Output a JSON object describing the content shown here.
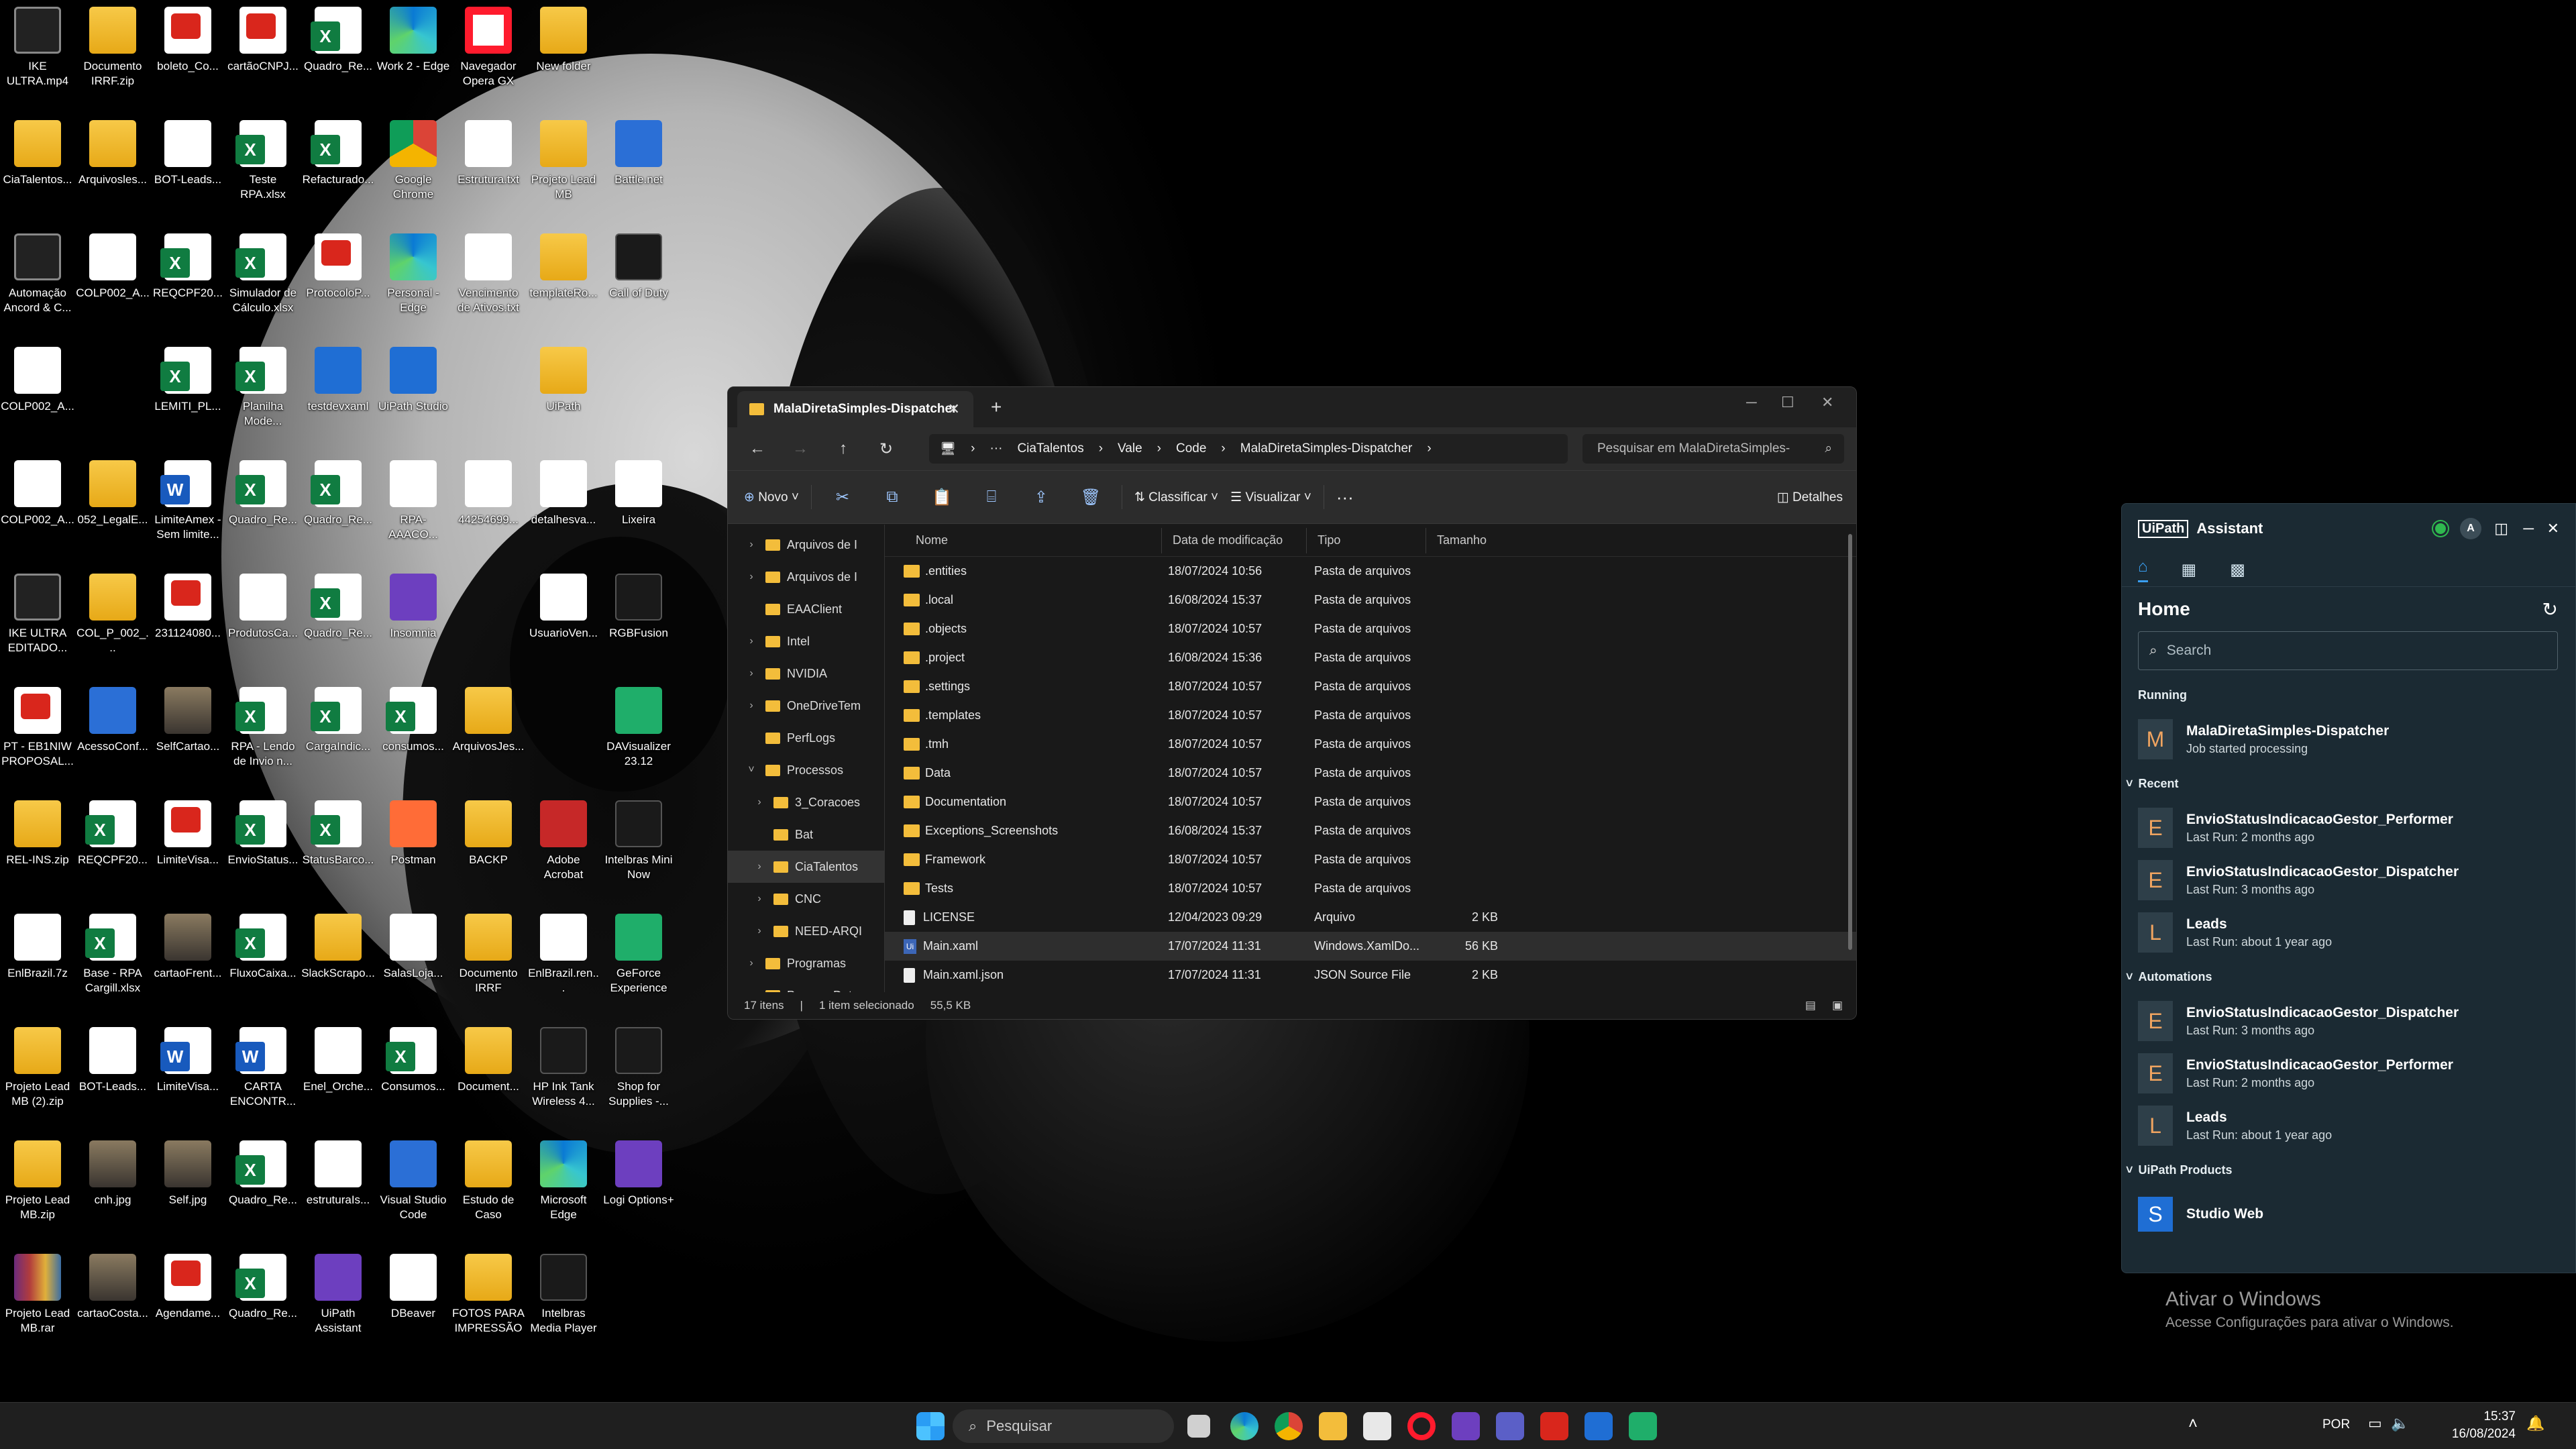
{
  "desktop_icons": [
    {
      "label": "IKE ULTRA.mp4",
      "kind": "video"
    },
    {
      "label": "Documento IRRF.zip",
      "kind": "folder"
    },
    {
      "label": "boleto_Co...",
      "kind": "pdf"
    },
    {
      "label": "cartãoCNPJ...",
      "kind": "pdf"
    },
    {
      "label": "Quadro_Re...",
      "kind": "xls"
    },
    {
      "label": "Work 2 - Edge",
      "kind": "edge"
    },
    {
      "label": "Navegador Opera GX",
      "kind": "opera"
    },
    {
      "label": "New folder",
      "kind": "folder"
    },
    {
      "label": "CiaTalentos...",
      "kind": "folder"
    },
    {
      "label": "Arquivosles...",
      "kind": "folder"
    },
    {
      "label": "BOT-Leads...",
      "kind": "doc"
    },
    {
      "label": "Teste RPA.xlsx",
      "kind": "xls"
    },
    {
      "label": "Refacturado...",
      "kind": "xls"
    },
    {
      "label": "Google Chrome",
      "kind": "chrome"
    },
    {
      "label": "Estrutura.txt",
      "kind": "doc"
    },
    {
      "label": "Projeto Lead MB",
      "kind": "folder"
    },
    {
      "label": "Battle.net",
      "kind": "blue"
    },
    {
      "label": "Automação Ancord & C...",
      "kind": "video"
    },
    {
      "label": "COLP002_A...",
      "kind": "doc"
    },
    {
      "label": "REQCPF20...",
      "kind": "xls"
    },
    {
      "label": "Simulador de Cálculo.xlsx",
      "kind": "xls"
    },
    {
      "label": "ProtocoloP...",
      "kind": "pdf"
    },
    {
      "label": "Personal - Edge",
      "kind": "edge"
    },
    {
      "label": "Vencimento de Ativos.txt",
      "kind": "doc"
    },
    {
      "label": "templateRo...",
      "kind": "folder"
    },
    {
      "label": "Call of Duty",
      "kind": "dark"
    },
    {
      "label": "COLP002_A...",
      "kind": "doc"
    },
    {
      "label": "LEMITI_PL...",
      "kind": "xls"
    },
    {
      "label": "Planilha Mode...",
      "kind": "xls"
    },
    {
      "label": "testdevxaml",
      "kind": "ui"
    },
    {
      "label": "UiPath Studio",
      "kind": "ui"
    },
    {
      "label": "UiPath",
      "kind": "folder"
    },
    {
      "label": "COLP002_A...",
      "kind": "doc"
    },
    {
      "label": "052_LegalE...",
      "kind": "folder"
    },
    {
      "label": "LimiteAmex - Sem limite...",
      "kind": "word"
    },
    {
      "label": "Quadro_Re...",
      "kind": "xls"
    },
    {
      "label": "Quadro_Re...",
      "kind": "xls"
    },
    {
      "label": "RPA-AAACO...",
      "kind": "doc"
    },
    {
      "label": "44254699...",
      "kind": "doc"
    },
    {
      "label": "detalhesva...",
      "kind": "doc"
    },
    {
      "label": "Lixeira",
      "kind": "doc"
    },
    {
      "label": "IKE ULTRA EDITADO...",
      "kind": "video"
    },
    {
      "label": "COL_P_002_...",
      "kind": "folder"
    },
    {
      "label": "231124080...",
      "kind": "pdf"
    },
    {
      "label": "ProdutosCa...",
      "kind": "doc"
    },
    {
      "label": "Quadro_Re...",
      "kind": "xls"
    },
    {
      "label": "Insomnia",
      "kind": "purple"
    },
    {
      "label": "UsuarioVen...",
      "kind": "doc"
    },
    {
      "label": "RGBFusion",
      "kind": "dark"
    },
    {
      "label": "PT - EB1NIW PROPOSAL...",
      "kind": "pdf"
    },
    {
      "label": "AcessoConf...",
      "kind": "blue"
    },
    {
      "label": "SelfCartao...",
      "kind": "img"
    },
    {
      "label": "RPA - Lendo de Invio n...",
      "kind": "xls"
    },
    {
      "label": "CargaIndic...",
      "kind": "xls"
    },
    {
      "label": "consumos...",
      "kind": "xls"
    },
    {
      "label": "ArquivosJes...",
      "kind": "folder"
    },
    {
      "label": "DAVisualizer 23.12",
      "kind": "green"
    },
    {
      "label": "REL-INS.zip",
      "kind": "folder"
    },
    {
      "label": "REQCPF20...",
      "kind": "xls"
    },
    {
      "label": "LimiteVisa...",
      "kind": "pdf"
    },
    {
      "label": "EnvioStatus...",
      "kind": "xls"
    },
    {
      "label": "StatusBarco...",
      "kind": "xls"
    },
    {
      "label": "Postman",
      "kind": "orange"
    },
    {
      "label": "BACKP",
      "kind": "folder"
    },
    {
      "label": "Adobe Acrobat",
      "kind": "red"
    },
    {
      "label": "Intelbras Mini Now",
      "kind": "dark"
    },
    {
      "label": "EnlBrazil.7z",
      "kind": "doc"
    },
    {
      "label": "Base - RPA Cargill.xlsx",
      "kind": "xls"
    },
    {
      "label": "cartaoFrent...",
      "kind": "img"
    },
    {
      "label": "FluxoCaixa...",
      "kind": "xls"
    },
    {
      "label": "SlackScrapo...",
      "kind": "folder"
    },
    {
      "label": "SalasLoja...",
      "kind": "doc"
    },
    {
      "label": "Documento IRRF",
      "kind": "folder"
    },
    {
      "label": "EnlBrazil.ren...",
      "kind": "doc"
    },
    {
      "label": "GeForce Experience",
      "kind": "green"
    },
    {
      "label": "Projeto Lead MB (2).zip",
      "kind": "folder"
    },
    {
      "label": "BOT-Leads...",
      "kind": "doc"
    },
    {
      "label": "LimiteVisa...",
      "kind": "word"
    },
    {
      "label": "CARTA ENCONTR...",
      "kind": "word"
    },
    {
      "label": "Enel_Orche...",
      "kind": "json"
    },
    {
      "label": "Consumos...",
      "kind": "xls"
    },
    {
      "label": "Document...",
      "kind": "folder"
    },
    {
      "label": "HP Ink Tank Wireless 4...",
      "kind": "dark"
    },
    {
      "label": "Shop for Supplies -...",
      "kind": "dark"
    },
    {
      "label": "Projeto Lead MB.zip",
      "kind": "folder"
    },
    {
      "label": "cnh.jpg",
      "kind": "img"
    },
    {
      "label": "Self.jpg",
      "kind": "img"
    },
    {
      "label": "Quadro_Re...",
      "kind": "xls"
    },
    {
      "label": "estruturaIs...",
      "kind": "doc"
    },
    {
      "label": "Visual Studio Code",
      "kind": "blue"
    },
    {
      "label": "Estudo de Caso",
      "kind": "folder"
    },
    {
      "label": "Microsoft Edge",
      "kind": "edge"
    },
    {
      "label": "Logi Options+",
      "kind": "purple"
    },
    {
      "label": "Projeto Lead MB.rar",
      "kind": "rar"
    },
    {
      "label": "cartaoCosta...",
      "kind": "img"
    },
    {
      "label": "Agendame...",
      "kind": "pdf"
    },
    {
      "label": "Quadro_Re...",
      "kind": "xls"
    },
    {
      "label": "UiPath Assistant",
      "kind": "purple"
    },
    {
      "label": "DBeaver",
      "kind": "doc"
    },
    {
      "label": "FOTOS PARA IMPRESSÃO",
      "kind": "folder"
    },
    {
      "label": "Intelbras Media Player",
      "kind": "dark"
    }
  ],
  "explorer": {
    "tab_title": "MalaDiretaSimples-Dispatcher",
    "breadcrumb": [
      "CiaTalentos",
      "Vale",
      "Code",
      "MalaDiretaSimples-Dispatcher"
    ],
    "search_placeholder": "Pesquisar em MalaDiretaSimples-",
    "toolbar": {
      "new": "Novo",
      "sort": "Classificar",
      "view": "Visualizar",
      "details": "Detalhes"
    },
    "tree": [
      {
        "label": "Arquivos de I",
        "indent": 1,
        "chev": ">"
      },
      {
        "label": "Arquivos de I",
        "indent": 1,
        "chev": ">"
      },
      {
        "label": "EAAClient",
        "indent": 1,
        "chev": ""
      },
      {
        "label": "Intel",
        "indent": 1,
        "chev": ">"
      },
      {
        "label": "NVIDIA",
        "indent": 1,
        "chev": ">"
      },
      {
        "label": "OneDriveTem",
        "indent": 1,
        "chev": ">"
      },
      {
        "label": "PerfLogs",
        "indent": 1,
        "chev": ""
      },
      {
        "label": "Processos",
        "indent": 1,
        "chev": "v"
      },
      {
        "label": "3_Coracoes",
        "indent": 2,
        "chev": ">"
      },
      {
        "label": "Bat",
        "indent": 2,
        "chev": ""
      },
      {
        "label": "CiaTalentos",
        "indent": 2,
        "chev": ">",
        "sel": true
      },
      {
        "label": "CNC",
        "indent": 2,
        "chev": ">"
      },
      {
        "label": "NEED-ARQI",
        "indent": 2,
        "chev": ">"
      },
      {
        "label": "Programas",
        "indent": 1,
        "chev": ">"
      },
      {
        "label": "ProgramData",
        "indent": 1,
        "chev": ">"
      }
    ],
    "columns": {
      "name": "Nome",
      "date": "Data de modificação",
      "type": "Tipo",
      "size": "Tamanho"
    },
    "files": [
      {
        "name": ".entities",
        "date": "18/07/2024 10:56",
        "type": "Pasta de arquivos",
        "size": "",
        "icon": "folder"
      },
      {
        "name": ".local",
        "date": "16/08/2024 15:37",
        "type": "Pasta de arquivos",
        "size": "",
        "icon": "folder"
      },
      {
        "name": ".objects",
        "date": "18/07/2024 10:57",
        "type": "Pasta de arquivos",
        "size": "",
        "icon": "folder"
      },
      {
        "name": ".project",
        "date": "16/08/2024 15:36",
        "type": "Pasta de arquivos",
        "size": "",
        "icon": "folder"
      },
      {
        "name": ".settings",
        "date": "18/07/2024 10:57",
        "type": "Pasta de arquivos",
        "size": "",
        "icon": "folder"
      },
      {
        "name": ".templates",
        "date": "18/07/2024 10:57",
        "type": "Pasta de arquivos",
        "size": "",
        "icon": "folder"
      },
      {
        "name": ".tmh",
        "date": "18/07/2024 10:57",
        "type": "Pasta de arquivos",
        "size": "",
        "icon": "folder"
      },
      {
        "name": "Data",
        "date": "18/07/2024 10:57",
        "type": "Pasta de arquivos",
        "size": "",
        "icon": "folder"
      },
      {
        "name": "Documentation",
        "date": "18/07/2024 10:57",
        "type": "Pasta de arquivos",
        "size": "",
        "icon": "folder"
      },
      {
        "name": "Exceptions_Screenshots",
        "date": "16/08/2024 15:37",
        "type": "Pasta de arquivos",
        "size": "",
        "icon": "folder"
      },
      {
        "name": "Framework",
        "date": "18/07/2024 10:57",
        "type": "Pasta de arquivos",
        "size": "",
        "icon": "folder"
      },
      {
        "name": "Tests",
        "date": "18/07/2024 10:57",
        "type": "Pasta de arquivos",
        "size": "",
        "icon": "folder"
      },
      {
        "name": "LICENSE",
        "date": "12/04/2023 09:29",
        "type": "Arquivo",
        "size": "2 KB",
        "icon": "file"
      },
      {
        "name": "Main.xaml",
        "date": "17/07/2024 11:31",
        "type": "Windows.XamlDo...",
        "size": "56 KB",
        "icon": "xaml",
        "sel": true
      },
      {
        "name": "Main.xaml.json",
        "date": "17/07/2024 11:31",
        "type": "JSON Source File",
        "size": "2 KB",
        "icon": "file"
      }
    ],
    "status": {
      "count": "17 itens",
      "selected": "1 item selecionado",
      "size": "55,5 KB"
    }
  },
  "uipath": {
    "brand": "UiPath",
    "title": "Assistant",
    "avatar_letter": "A",
    "home": "Home",
    "search_placeholder": "Search",
    "running_label": "Running",
    "running": [
      {
        "letter": "M",
        "name": "MalaDiretaSimples-Dispatcher",
        "sub": "Job started processing"
      }
    ],
    "recent_label": "Recent",
    "recent": [
      {
        "letter": "E",
        "name": "EnvioStatusIndicacaoGestor_Performer",
        "sub": "Last Run: 2 months ago"
      },
      {
        "letter": "E",
        "name": "EnvioStatusIndicacaoGestor_Dispatcher",
        "sub": "Last Run: 3 months ago"
      },
      {
        "letter": "L",
        "name": "Leads",
        "sub": "Last Run: about 1 year ago"
      }
    ],
    "automations_label": "Automations",
    "automations": [
      {
        "letter": "E",
        "name": "EnvioStatusIndicacaoGestor_Dispatcher",
        "sub": "Last Run: 3 months ago"
      },
      {
        "letter": "E",
        "name": "EnvioStatusIndicacaoGestor_Performer",
        "sub": "Last Run: 2 months ago"
      },
      {
        "letter": "L",
        "name": "Leads",
        "sub": "Last Run: about 1 year ago"
      }
    ],
    "products_label": "UiPath Products",
    "products": [
      {
        "name": "Studio Web"
      }
    ]
  },
  "activate": {
    "title": "Ativar o Windows",
    "sub": "Acesse Configurações para ativar o Windows."
  },
  "taskbar": {
    "search": "Pesquisar",
    "lang": "POR",
    "time": "15:37",
    "date": "16/08/2024"
  },
  "colors": {
    "accent": "#3a9ff2",
    "folder": "#f3bd3b",
    "excel": "#107c41",
    "pdf": "#d9261c"
  }
}
